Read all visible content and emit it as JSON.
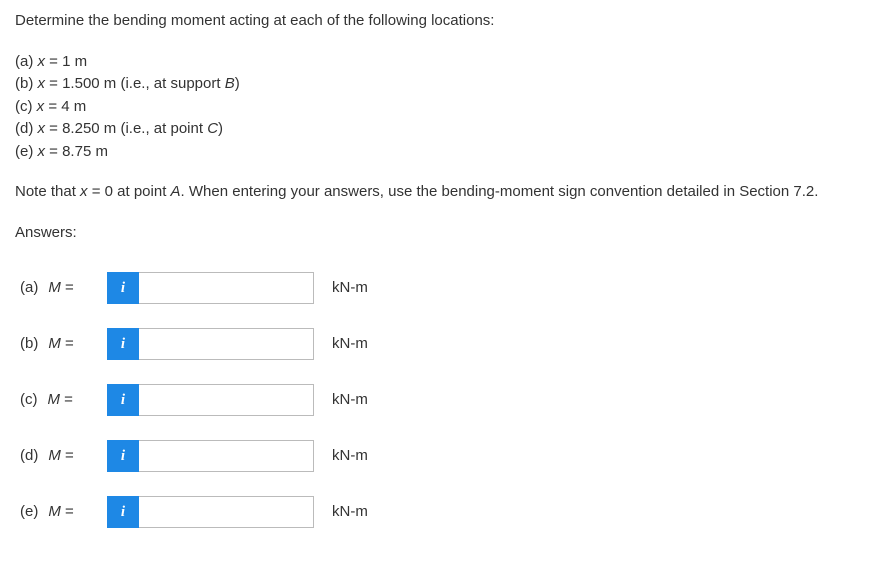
{
  "intro": "Determine the bending moment acting at each of the following locations:",
  "locations": [
    {
      "label": "(a) ",
      "var": "x",
      "eq": " = 1 m",
      "note": ""
    },
    {
      "label": "(b) ",
      "var": "x",
      "eq": " = 1.500 m (i.e., at support ",
      "note_italic": "B",
      "note_after": ")"
    },
    {
      "label": "(c) ",
      "var": "x",
      "eq": " = 4 m",
      "note": ""
    },
    {
      "label": "(d) ",
      "var": "x",
      "eq": " = 8.250 m (i.e., at point ",
      "note_italic": "C",
      "note_after": ")"
    },
    {
      "label": "(e) ",
      "var": "x",
      "eq": " = 8.75 m",
      "note": ""
    }
  ],
  "note": {
    "pre": "Note that ",
    "var": "x",
    "mid": " = 0 at point ",
    "point": "A",
    "post": ". When entering your answers, use the bending-moment sign convention detailed in Section 7.2."
  },
  "answers_title": "Answers:",
  "info_icon": "i",
  "unit": "kN-m",
  "answers": [
    {
      "paren": "(a)",
      "label": "M",
      "eq": " =",
      "value": ""
    },
    {
      "paren": "(b)",
      "label": "M",
      "eq": " =",
      "value": ""
    },
    {
      "paren": "(c)",
      "label": "M",
      "eq": " =",
      "value": ""
    },
    {
      "paren": "(d)",
      "label": "M",
      "eq": " =",
      "value": ""
    },
    {
      "paren": "(e)",
      "label": "M",
      "eq": " =",
      "value": ""
    }
  ]
}
